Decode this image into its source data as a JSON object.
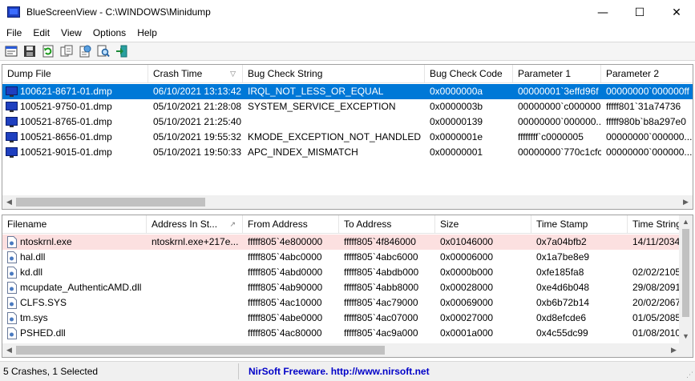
{
  "window": {
    "title": "BlueScreenView  -  C:\\WINDOWS\\Minidump",
    "minimize_glyph": "—",
    "maximize_glyph": "☐",
    "close_glyph": "✕"
  },
  "menu": [
    "File",
    "Edit",
    "View",
    "Options",
    "Help"
  ],
  "toolbar": {
    "icons": [
      "properties-icon",
      "save-icon",
      "refresh-icon",
      "copy-icon",
      "html-report-icon",
      "find-icon",
      "exit-icon"
    ]
  },
  "top_table": {
    "columns": [
      "Dump File",
      "Crash Time",
      "Bug Check String",
      "Bug Check Code",
      "Parameter 1",
      "Parameter 2"
    ],
    "sort_indicator": "▽",
    "rows": [
      {
        "dump": "100621-8671-01.dmp",
        "time": "06/10/2021 13:13:42",
        "bug": "IRQL_NOT_LESS_OR_EQUAL",
        "code": "0x0000000a",
        "p1": "00000001`3effd96f",
        "p2": "00000000`000000ff",
        "selected": true
      },
      {
        "dump": "100521-9750-01.dmp",
        "time": "05/10/2021 21:28:08",
        "bug": "SYSTEM_SERVICE_EXCEPTION",
        "code": "0x0000003b",
        "p1": "00000000`c000000...",
        "p2": "fffff801`31a74736",
        "selected": false
      },
      {
        "dump": "100521-8765-01.dmp",
        "time": "05/10/2021 21:25:40",
        "bug": "",
        "code": "0x00000139",
        "p1": "00000000`000000...",
        "p2": "fffff980b`b8a297e0",
        "selected": false
      },
      {
        "dump": "100521-8656-01.dmp",
        "time": "05/10/2021 19:55:32",
        "bug": "KMODE_EXCEPTION_NOT_HANDLED",
        "code": "0x0000001e",
        "p1": "ffffffff`c0000005",
        "p2": "00000000`000000...",
        "selected": false
      },
      {
        "dump": "100521-9015-01.dmp",
        "time": "05/10/2021 19:50:33",
        "bug": "APC_INDEX_MISMATCH",
        "code": "0x00000001",
        "p1": "00000000`770c1cfc",
        "p2": "00000000`000000...",
        "selected": false
      }
    ]
  },
  "bottom_table": {
    "columns": [
      "Filename",
      "Address In St...",
      "From Address",
      "To Address",
      "Size",
      "Time Stamp",
      "Time String"
    ],
    "sort_indicator": "↗",
    "rows": [
      {
        "file": "ntoskrnl.exe",
        "addr": "ntoskrnl.exe+217e...",
        "from": "fffff805`4e800000",
        "to": "fffff805`4f846000",
        "size": "0x01046000",
        "stamp": "0x7a04bfb2",
        "tstr": "14/11/2034",
        "highlight": true
      },
      {
        "file": "hal.dll",
        "addr": "",
        "from": "fffff805`4abc0000",
        "to": "fffff805`4abc6000",
        "size": "0x00006000",
        "stamp": "0x1a7be8e9",
        "tstr": "",
        "highlight": false
      },
      {
        "file": "kd.dll",
        "addr": "",
        "from": "fffff805`4abd0000",
        "to": "fffff805`4abdb000",
        "size": "0x0000b000",
        "stamp": "0xfe185fa8",
        "tstr": "02/02/2105",
        "highlight": false
      },
      {
        "file": "mcupdate_AuthenticAMD.dll",
        "addr": "",
        "from": "fffff805`4ab90000",
        "to": "fffff805`4abb8000",
        "size": "0x00028000",
        "stamp": "0xe4d6b048",
        "tstr": "29/08/2091",
        "highlight": false
      },
      {
        "file": "CLFS.SYS",
        "addr": "",
        "from": "fffff805`4ac10000",
        "to": "fffff805`4ac79000",
        "size": "0x00069000",
        "stamp": "0xb6b72b14",
        "tstr": "20/02/2067",
        "highlight": false
      },
      {
        "file": "tm.sys",
        "addr": "",
        "from": "fffff805`4abe0000",
        "to": "fffff805`4ac07000",
        "size": "0x00027000",
        "stamp": "0xd8efcde6",
        "tstr": "01/05/2085",
        "highlight": false
      },
      {
        "file": "PSHED.dll",
        "addr": "",
        "from": "fffff805`4ac80000",
        "to": "fffff805`4ac9a000",
        "size": "0x0001a000",
        "stamp": "0x4c55dc99",
        "tstr": "01/08/2010",
        "highlight": false
      }
    ]
  },
  "status": {
    "text": "5 Crashes, 1 Selected",
    "link": "NirSoft Freeware.  http://www.nirsoft.net"
  },
  "colors": {
    "selection": "#0078d7",
    "highlight_row": "#fce0e0",
    "link": "#0000c8"
  }
}
